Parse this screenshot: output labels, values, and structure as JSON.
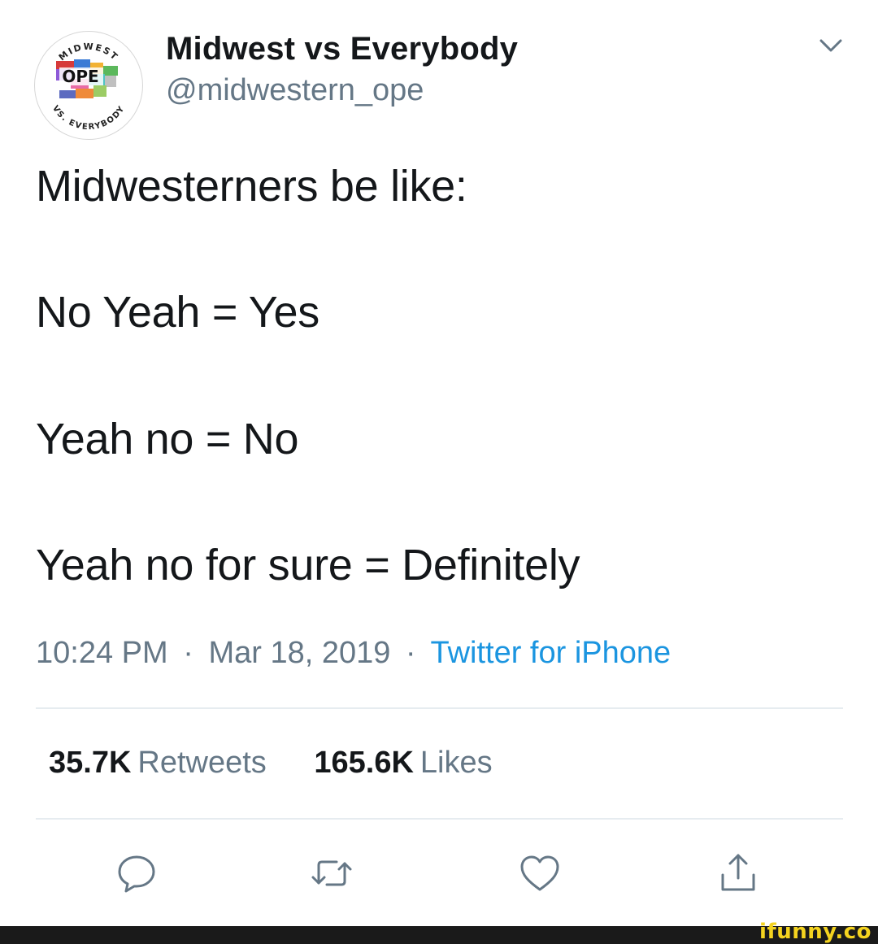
{
  "author": {
    "display_name": "Midwest vs Everybody",
    "handle": "@midwestern_ope",
    "avatar_text": {
      "top": "MIDWEST",
      "center": "OPE",
      "bottom": "VS. EVERYBODY"
    }
  },
  "tweet": {
    "lines": [
      "Midwesterners be like:",
      "No Yeah = Yes",
      "Yeah no = No",
      "Yeah no for sure = Definitely"
    ],
    "time": "10:24 PM",
    "date": "Mar 18, 2019",
    "separator": "·",
    "source": "Twitter for iPhone"
  },
  "stats": {
    "retweets_count": "35.7K",
    "retweets_label": "Retweets",
    "likes_count": "165.6K",
    "likes_label": "Likes"
  },
  "actions": {
    "reply_icon": "reply-icon",
    "retweet_icon": "retweet-icon",
    "like_icon": "heart-icon",
    "share_icon": "share-icon"
  },
  "footer": {
    "watermark": "ifunny.co"
  },
  "colors": {
    "text": "#14171a",
    "secondary": "#657786",
    "link": "#1b95e0",
    "divider": "#e6ecf0",
    "watermark": "#f4d31f"
  }
}
